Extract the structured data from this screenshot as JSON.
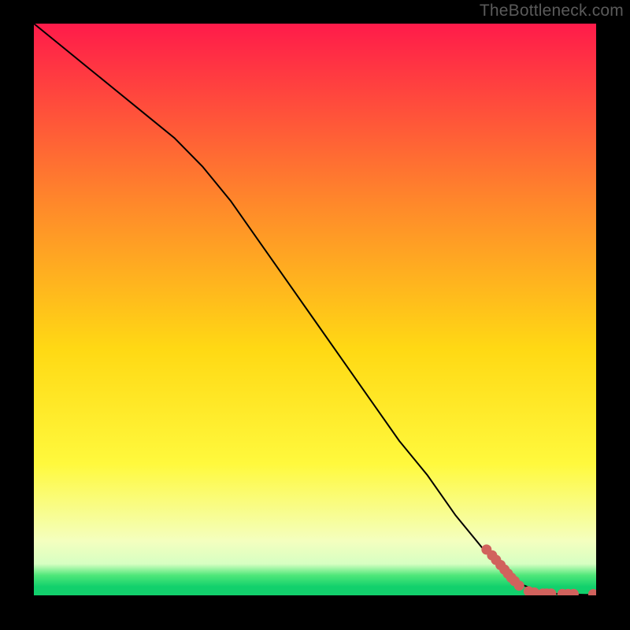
{
  "watermark": "TheBottleneck.com",
  "colors": {
    "bg": "#000000",
    "gradient_top": "#ff1b4a",
    "gradient_mid_upper": "#ff8a2a",
    "gradient_mid": "#ffd914",
    "gradient_lower": "#fff93d",
    "gradient_pale": "#f4ffbf",
    "gradient_green1": "#4fe77a",
    "gradient_green2": "#12d06c",
    "line": "#000000",
    "marker": "#d1625d"
  },
  "chart_data": {
    "type": "line",
    "title": "",
    "xlabel": "",
    "ylabel": "",
    "xlim": [
      0,
      100
    ],
    "ylim": [
      0,
      100
    ],
    "grid": false,
    "series": [
      {
        "name": "curve",
        "type": "line",
        "x": [
          0,
          5,
          10,
          15,
          20,
          25,
          30,
          35,
          40,
          45,
          50,
          55,
          60,
          65,
          70,
          75,
          80,
          83,
          85,
          87,
          89,
          90,
          92,
          94,
          96,
          98,
          100
        ],
        "y": [
          100,
          96,
          92,
          88,
          84,
          80,
          75,
          69,
          62,
          55,
          48,
          41,
          34,
          27,
          21,
          14,
          8,
          5,
          3,
          1.8,
          1,
          0.6,
          0.3,
          0.2,
          0.15,
          0.1,
          0.1
        ]
      },
      {
        "name": "points",
        "type": "scatter",
        "x": [
          80.5,
          81.5,
          82.2,
          83.0,
          83.7,
          84.3,
          84.9,
          85.5,
          86.3,
          88.0,
          89.0,
          90.5,
          91.2,
          92.0,
          94.0,
          95.0,
          96.0,
          99.5
        ],
        "y": [
          8.0,
          7.0,
          6.2,
          5.3,
          4.5,
          3.8,
          3.1,
          2.5,
          1.7,
          0.7,
          0.5,
          0.3,
          0.3,
          0.3,
          0.25,
          0.25,
          0.25,
          0.2
        ]
      }
    ]
  }
}
